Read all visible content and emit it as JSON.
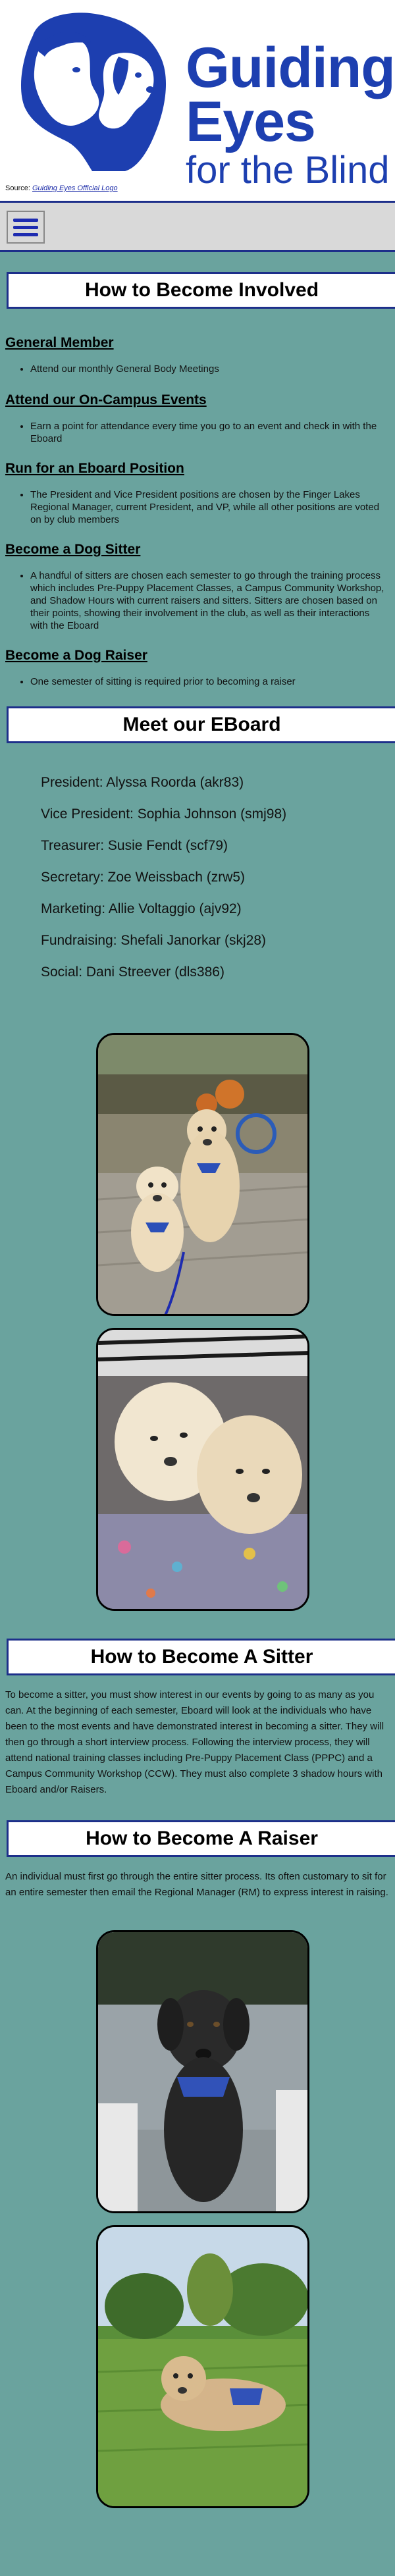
{
  "header": {
    "logo": {
      "line1": "Guiding",
      "line2": "Eyes",
      "line3": "for the Blind"
    },
    "source_prefix": "Source: ",
    "source_link": "Guiding Eyes Official Logo"
  },
  "nav": {
    "menu_icon": "hamburger-menu-icon"
  },
  "involved": {
    "title": "How to Become Involved",
    "items": [
      {
        "heading": "General Member",
        "bullet": "Attend our monthly General Body Meetings"
      },
      {
        "heading": "Attend our On-Campus Events",
        "bullet": "Earn a point for attendance every time you go to an event and check in with the Eboard"
      },
      {
        "heading": "Run for an Eboard Position",
        "bullet": "The President and Vice President positions are chosen by the Finger Lakes Regional Manager, current President, and VP, while all other positions are voted on by club members"
      },
      {
        "heading": "Become a Dog Sitter",
        "bullet": "A handful of sitters are chosen each semester to go through the training process which includes Pre-Puppy Placement Classes, a Campus Community Workshop, and Shadow Hours with current raisers and sitters. Sitters are chosen based on their points, showing their involvement in the club, as well as their interactions with the Eboard"
      },
      {
        "heading": "Become a Dog Raiser",
        "bullet": "One semester of sitting is required prior to becoming a raiser"
      }
    ]
  },
  "eboard": {
    "title": "Meet our EBoard",
    "members": [
      "President: Alyssa Roorda (akr83)",
      "Vice President: Sophia Johnson (smj98)",
      "Treasurer: Susie Fendt (scf79)",
      "Secretary: Zoe Weissbach (zrw5)",
      "Marketing: Allie Voltaggio (ajv92)",
      "Fundraising: Shefali Janorkar (skj28)",
      "Social: Dani Streever (dls386)"
    ]
  },
  "sitter": {
    "title": "How to Become A Sitter",
    "text": "To become a sitter, you must show interest in our events by going to as many as you can. At the beginning of each semester, Eboard will look at the individuals who have been to the most events and have demonstrated interest in becoming a sitter. They will then go through a short interview process. Following the interview process, they will attend national training classes including Pre-Puppy Placement Class (PPPC) and a Campus Community Workshop (CCW). They must also complete 3 shadow hours with Eboard and/or Raisers."
  },
  "raiser": {
    "title": "How to Become A Raiser",
    "text": "An individual must first go through the entire sitter process. Its often customary to sit for an entire semester then email the Regional Manager (RM) to express interest in raising."
  }
}
